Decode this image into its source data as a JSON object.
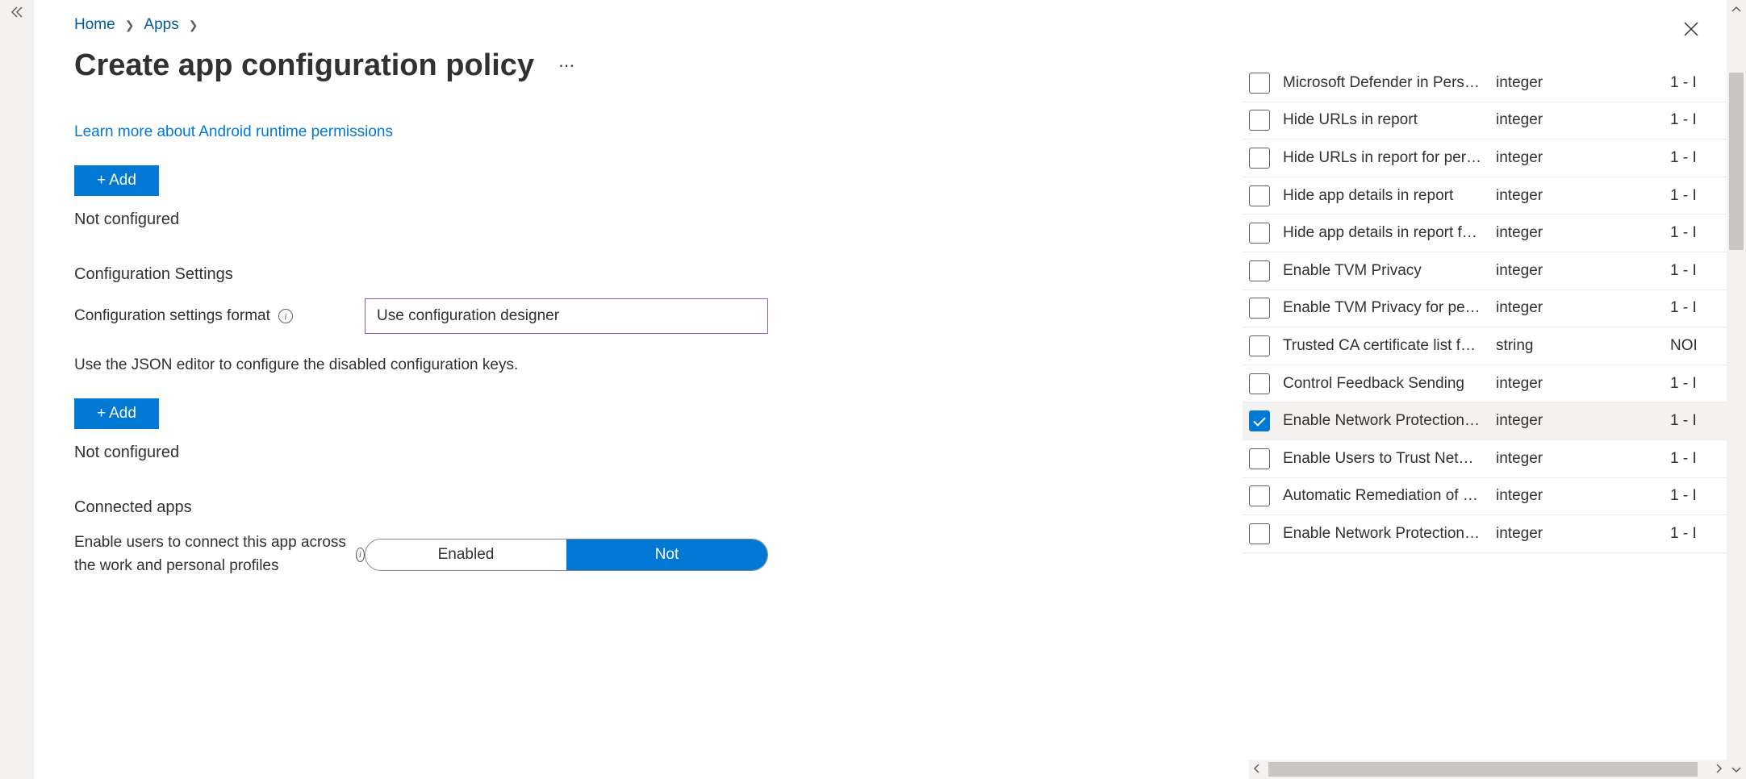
{
  "breadcrumb": {
    "home": "Home",
    "apps": "Apps"
  },
  "page": {
    "title": "Create app configuration policy"
  },
  "links": {
    "learn_more": "Learn more about Android runtime permissions"
  },
  "buttons": {
    "add": "Add"
  },
  "status": {
    "not_configured": "Not configured"
  },
  "sections": {
    "config_settings": "Configuration Settings",
    "config_format_label": "Configuration settings format",
    "config_format_value": "Use configuration designer",
    "json_hint": "Use the JSON editor to configure the disabled configuration keys.",
    "connected_apps": "Connected apps",
    "connected_desc": "Enable users to connect this app across the work and personal profiles"
  },
  "toggle": {
    "enabled": "Enabled",
    "not": "Not"
  },
  "panel": {
    "rows": [
      {
        "key": "Microsoft Defender in Perso…",
        "type": "integer",
        "val": "1 - I",
        "checked": false
      },
      {
        "key": "Hide URLs in report",
        "type": "integer",
        "val": "1 - I",
        "checked": false
      },
      {
        "key": "Hide URLs in report for pers…",
        "type": "integer",
        "val": "1 - I",
        "checked": false
      },
      {
        "key": "Hide app details in report",
        "type": "integer",
        "val": "1 - I",
        "checked": false
      },
      {
        "key": "Hide app details in report f…",
        "type": "integer",
        "val": "1 - I",
        "checked": false
      },
      {
        "key": "Enable TVM Privacy",
        "type": "integer",
        "val": "1 - I",
        "checked": false
      },
      {
        "key": "Enable TVM Privacy for pers…",
        "type": "integer",
        "val": "1 - I",
        "checked": false
      },
      {
        "key": "Trusted CA certificate list for…",
        "type": "string",
        "val": "NOI",
        "checked": false
      },
      {
        "key": "Control Feedback Sending",
        "type": "integer",
        "val": "1 - I",
        "checked": false
      },
      {
        "key": "Enable Network Protection i…",
        "type": "integer",
        "val": "1 - I",
        "checked": true
      },
      {
        "key": "Enable Users to Trust Netwo…",
        "type": "integer",
        "val": "1 - I",
        "checked": false
      },
      {
        "key": "Automatic Remediation of …",
        "type": "integer",
        "val": "1 - I",
        "checked": false
      },
      {
        "key": "Enable Network Protection …",
        "type": "integer",
        "val": "1 - I",
        "checked": false
      }
    ]
  }
}
